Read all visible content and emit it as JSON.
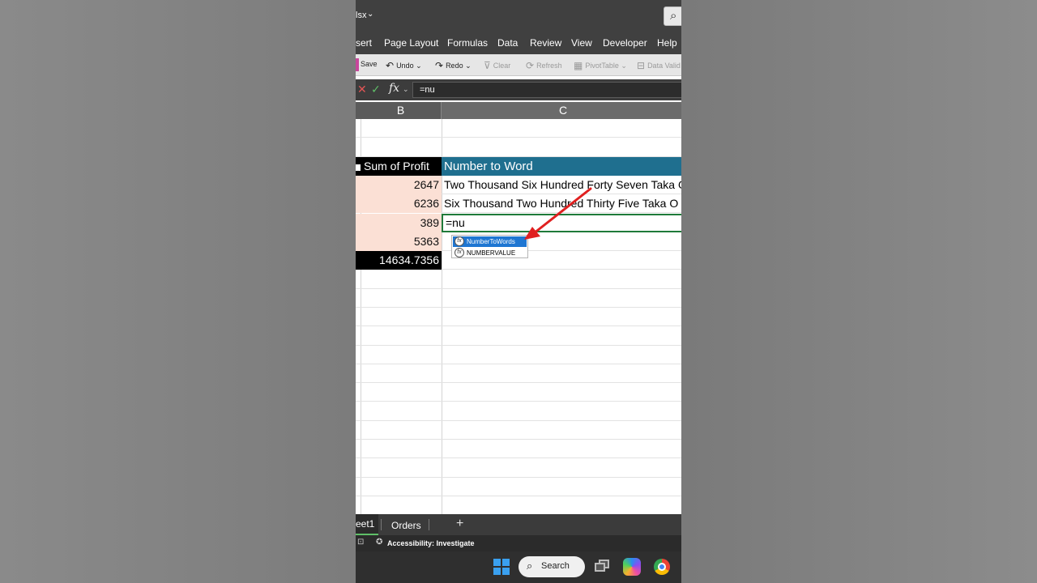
{
  "window": {
    "title_fragment": "lsx"
  },
  "menu": {
    "tabs": [
      "sert",
      "Page Layout",
      "Formulas",
      "Data",
      "Review",
      "View",
      "Developer",
      "Help"
    ]
  },
  "toolbar": {
    "save": "Save",
    "undo": "Undo",
    "redo": "Redo",
    "clear": "Clear",
    "refresh": "Refresh",
    "pivottable": "PivotTable",
    "data_validation": "Data Valid"
  },
  "formula_bar": {
    "fx_label": "fx",
    "value": "=nu"
  },
  "columns": {
    "b": "B",
    "c": "C"
  },
  "table": {
    "header_b": "Sum of Profit",
    "header_c": "Number to Word",
    "rows": [
      {
        "b": "2647",
        "c": "Two Thousand Six Hundred Forty Seven Taka O"
      },
      {
        "b": "6236",
        "c": "Six Thousand Two Hundred Thirty Five Taka O"
      },
      {
        "b": "389",
        "c": "=nu"
      },
      {
        "b": "5363",
        "c": ""
      }
    ],
    "total_b": "14634.7356"
  },
  "autocomplete": {
    "options": [
      "NumberToWords",
      "NUMBERVALUE"
    ],
    "selected_index": 0
  },
  "sheet_tabs": {
    "active": "eet1",
    "other": "Orders",
    "add": "+"
  },
  "status_bar": {
    "accessibility": "Accessibility: Investigate"
  },
  "taskbar": {
    "search_label": "Search"
  },
  "colors": {
    "header_fill": "#1f6f8f",
    "data_fill": "#fbe0d5",
    "edit_border": "#1f7a3a",
    "accent_arrow": "#e02020"
  }
}
